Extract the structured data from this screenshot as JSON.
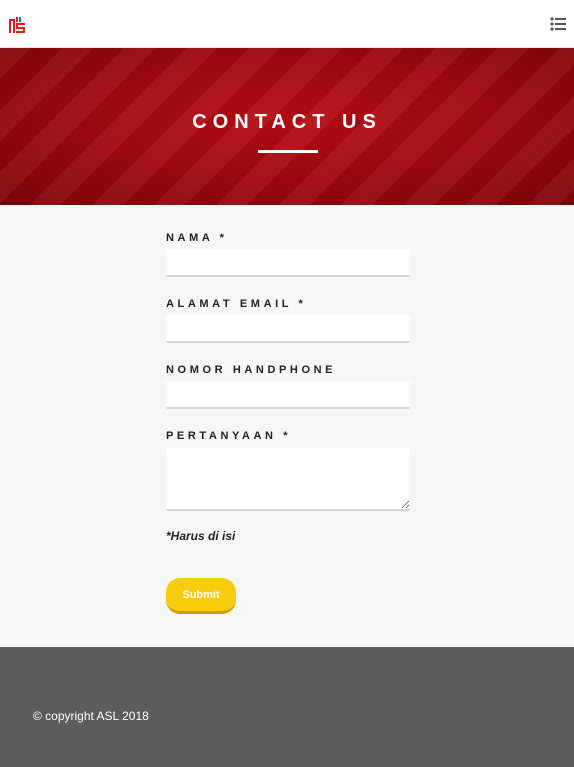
{
  "header": {
    "logo_icon": "asl-logo-icon",
    "menu_icon": "list-menu-icon",
    "brand_color": "#e31b23"
  },
  "hero": {
    "title": "CONTACT US",
    "bg_color": "#a3080f"
  },
  "form": {
    "fields": [
      {
        "label": "NAMA *",
        "value": ""
      },
      {
        "label": "ALAMAT EMAIL *",
        "value": ""
      },
      {
        "label": "NOMOR HANDPHONE",
        "value": ""
      },
      {
        "label": "PERTANYAAN *",
        "value": ""
      }
    ],
    "required_note": "*Harus di isi",
    "submit_label": "Submit",
    "submit_color": "#f9cc0b"
  },
  "footer": {
    "copyright": "© copyright ASL 2018",
    "bg_color": "#5c5c5c"
  }
}
